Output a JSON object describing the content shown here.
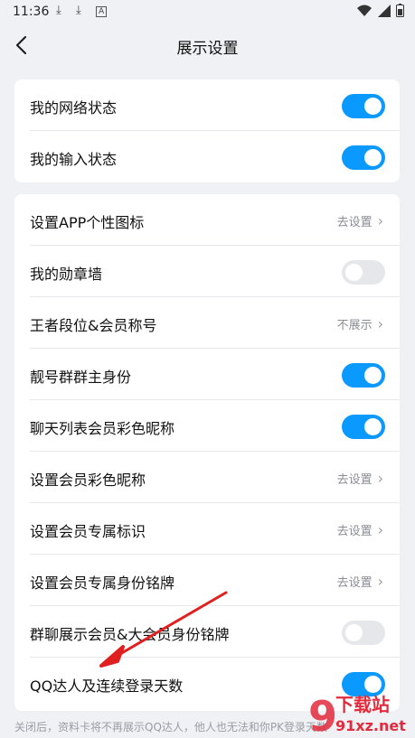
{
  "status": {
    "time": "11:36",
    "download_icon_1": "download-icon",
    "download_icon_2": "download-icon",
    "a_icon": "A"
  },
  "header": {
    "title": "展示设置"
  },
  "group1": [
    {
      "label": "我的网络状态",
      "on": true
    },
    {
      "label": "我的输入状态",
      "on": true
    }
  ],
  "group2": [
    {
      "label": "设置APP个性图标",
      "value": "去设置"
    },
    {
      "label": "我的勋章墙",
      "on": false
    },
    {
      "label": "王者段位&会员称号",
      "value": "不展示"
    },
    {
      "label": "靓号群群主身份",
      "on": true
    },
    {
      "label": "聊天列表会员彩色昵称",
      "on": true
    },
    {
      "label": "设置会员彩色昵称",
      "value": "去设置"
    },
    {
      "label": "设置会员专属标识",
      "value": "去设置"
    },
    {
      "label": "设置会员专属身份铭牌",
      "value": "去设置"
    },
    {
      "label": "群聊展示会员&大会员身份铭牌",
      "on": false
    },
    {
      "label": "QQ达人及连续登录天数",
      "on": true
    }
  ],
  "footnote": "关闭后，资料卡将不再展示QQ达人，他人也无法和你PK登录天数",
  "watermark": {
    "text": "下载站",
    "sub": "91xz.net"
  },
  "colors": {
    "accent": "#0a99ff",
    "arrow": "#e02020"
  }
}
